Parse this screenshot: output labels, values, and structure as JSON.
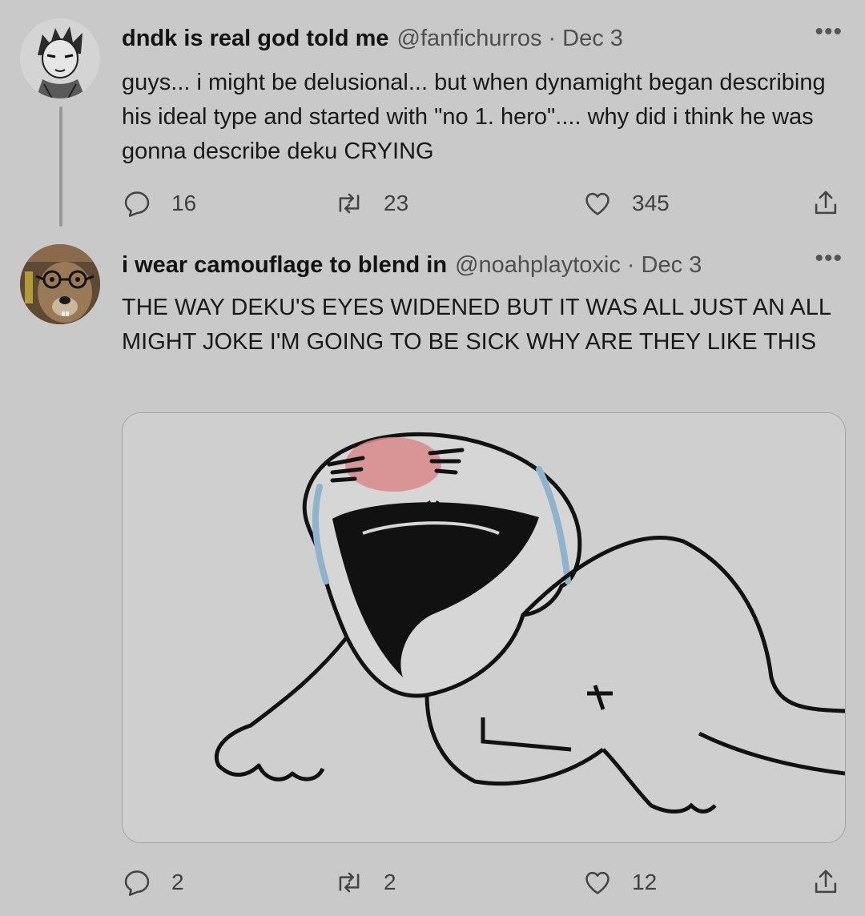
{
  "tweets": [
    {
      "display_name": "dndk is real god told me",
      "handle": "@fanfichurros",
      "separator": "·",
      "date": "Dec 3",
      "text": "guys... i might be delusional... but when dynamight began describing his ideal type and started with \"no 1. hero\".... why did i think he was gonna describe deku CRYING",
      "more_icon": "more-horizontal-icon",
      "replies": "16",
      "retweets": "23",
      "likes": "345"
    },
    {
      "display_name": "i wear camouflage to blend in",
      "handle": "@noahplaytoxic",
      "separator": "·",
      "date": "Dec 3",
      "text": "THE WAY DEKU'S EYES WIDENED BUT IT WAS ALL JUST AN ALL MIGHT JOKE I'M GOING TO BE SICK WHY ARE THEY LIKE THIS",
      "more_icon": "more-horizontal-icon",
      "media": "crying-meme-image",
      "replies": "2",
      "retweets": "2",
      "likes": "12"
    }
  ],
  "icons": {
    "reply": "reply-icon",
    "retweet": "retweet-icon",
    "like": "heart-icon",
    "share": "share-icon"
  },
  "colors": {
    "background": "#c9c9c9",
    "text": "#171717",
    "muted": "#4f4f4f",
    "blush": "#d98a8a",
    "tears": "#8fb3cc"
  }
}
